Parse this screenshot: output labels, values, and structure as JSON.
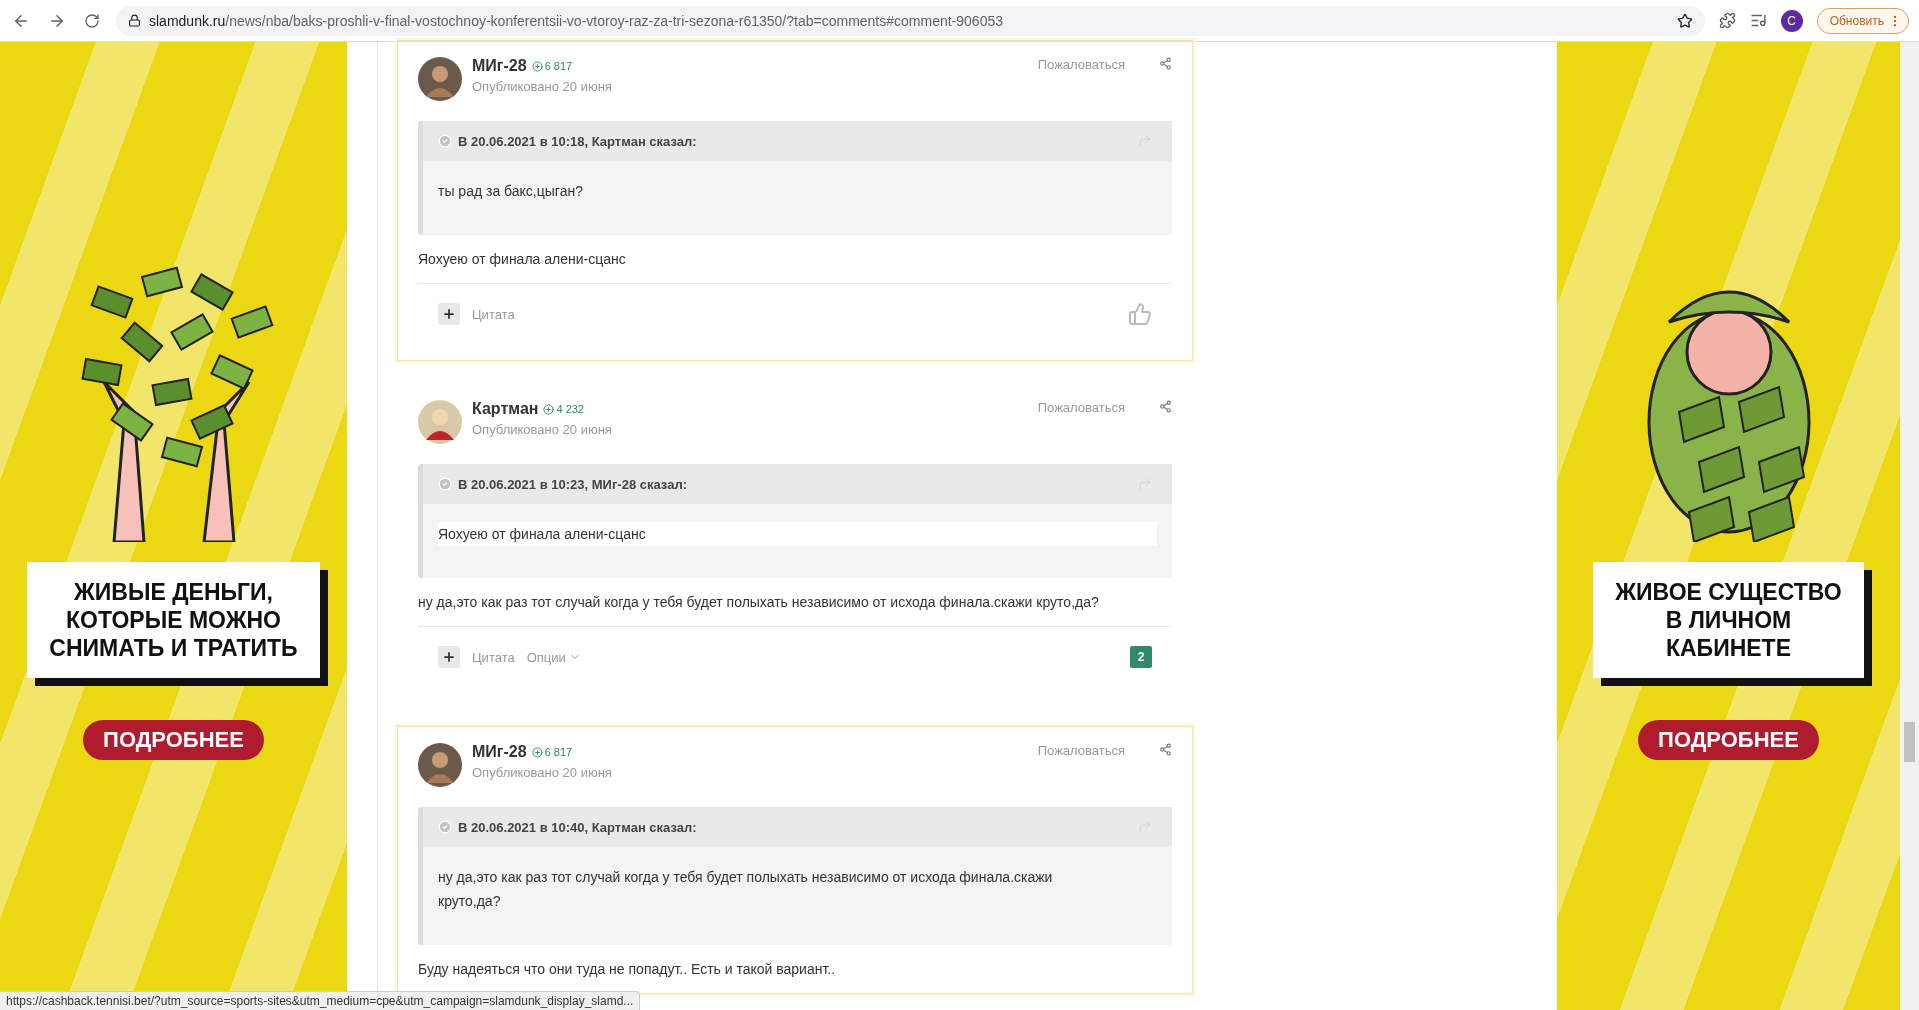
{
  "browser": {
    "url_host": "slamdunk.ru",
    "url_path": "/news/nba/baks-proshli-v-final-vostochnoy-konferentsii-vo-vtoroy-raz-za-tri-sezona-r61350/?tab=comments#comment-906053",
    "profile_initial": "C",
    "update_button": "Обновить"
  },
  "ads": [
    {
      "kind": "money",
      "headline": [
        "ЖИВЫЕ ДЕНЬГИ,",
        "КОТОРЫЕ МОЖНО",
        "СНИМАТЬ И ТРАТИТЬ"
      ],
      "button": "ПОДРОБНЕЕ"
    },
    {
      "kind": "creature",
      "headline": [
        "ЖИВОЕ СУЩЕСТВО",
        "В ЛИЧНОМ",
        "КАБИНЕТЕ"
      ],
      "button": "ПОДРОБНЕЕ"
    }
  ],
  "comments": [
    {
      "highlighted": true,
      "author": "МИг-28",
      "reputation": "6 817",
      "published": "Опубликовано 20 июня",
      "report": "Пожаловаться",
      "quote": {
        "header": "В 20.06.2021 в 10:18, Картман сказал:",
        "text": "ты рад за бакс,цыган?",
        "boxed": false
      },
      "body": "Яохуею от финала алени-сцанс",
      "footer": {
        "actions": [
          "Цитата"
        ],
        "reaction": {
          "kind": "like"
        }
      }
    },
    {
      "highlighted": false,
      "author": "Картман",
      "reputation": "4 232",
      "published": "Опубликовано 20 июня",
      "report": "Пожаловаться",
      "quote": {
        "header": "В 20.06.2021 в 10:23, МИг-28 сказал:",
        "text": "Яохуею от финала алени-сцанс",
        "boxed": true
      },
      "body": "ну да,это как раз тот случай когда у тебя будет полыхать независимо от исхода финала.скажи круто,да?",
      "footer": {
        "actions": [
          "Цитата"
        ],
        "options": "Опции",
        "reaction": {
          "kind": "count",
          "count": "2"
        }
      }
    },
    {
      "highlighted": true,
      "author": "МИг-28",
      "reputation": "6 817",
      "published": "Опубликовано 20 июня",
      "report": "Пожаловаться",
      "quote": {
        "header": "В 20.06.2021 в 10:40, Картман сказал:",
        "text": "ну да,это как раз тот случай когда у тебя будет полыхать независимо от исхода финала.скажи круто,да?",
        "boxed": false
      },
      "body": "Буду надеяться что они туда не попадут.. Есть и такой вариант.."
    }
  ],
  "status_url": "https://cashback.tennisi.bet/?utm_source=sports-sites&utm_medium=cpe&utm_campaign=slamdunk_display_slamd..."
}
